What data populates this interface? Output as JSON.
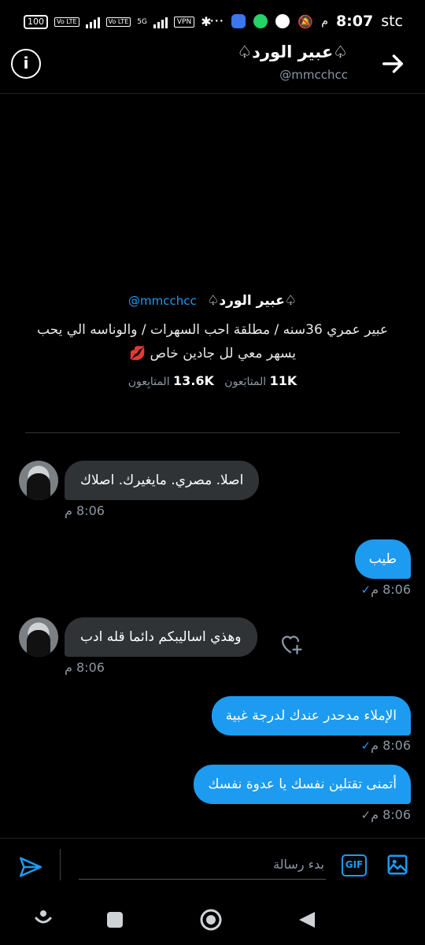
{
  "status_bar": {
    "time": "8:07",
    "period": "م",
    "carrier": "stc",
    "battery": "100",
    "network_badges": [
      "Vo LTE",
      "Vo LTE",
      "5G"
    ],
    "vpn": "VPN",
    "more": "···"
  },
  "header": {
    "name": "♤عبير الورد♤",
    "handle": "@mmcchcc"
  },
  "profile_card": {
    "name": "♤عبير الورد♤",
    "handle": "@mmcchcc",
    "bio_line1": "عبير عمري 36سنه / مطلقة  احب السهرات  /  والوناسه الي يحب",
    "bio_line2": "يسهر معي لل جادين   خاص 💋",
    "following_count": "11K",
    "following_label": "المتابَعون",
    "followers_count": "13.6K",
    "followers_label": "المتابِعون"
  },
  "messages": [
    {
      "direction": "in",
      "text": "اصلا.  مصري. مايغيرك. اصلاك",
      "time": "8:06 م"
    },
    {
      "direction": "out",
      "text": "طيب",
      "time": "8:06 م"
    },
    {
      "direction": "in",
      "text": "وهذي  اساليبكم  دائما  قله ادب",
      "time": "8:06 م"
    },
    {
      "direction": "out",
      "text": "الإملاء مدحدر عندك لدرجة غبية",
      "time": "8:06 م"
    },
    {
      "direction": "out",
      "text": "أتمنى تقتلين نفسك يا عدوة نفسك",
      "time": "8:06 م"
    }
  ],
  "composer": {
    "placeholder": "بدء رسالة",
    "gif_label": "GIF"
  },
  "colors": {
    "accent": "#1d9bf0",
    "background": "#000000",
    "incoming_bubble": "#2f3336",
    "muted": "#8b98a5"
  },
  "icons": [
    "info-icon",
    "arrow-right-icon",
    "send-icon",
    "gif-icon",
    "image-icon",
    "heart-add-icon",
    "check-icon",
    "nav-assistant-icon",
    "nav-recents-icon",
    "nav-home-icon",
    "nav-back-icon"
  ]
}
